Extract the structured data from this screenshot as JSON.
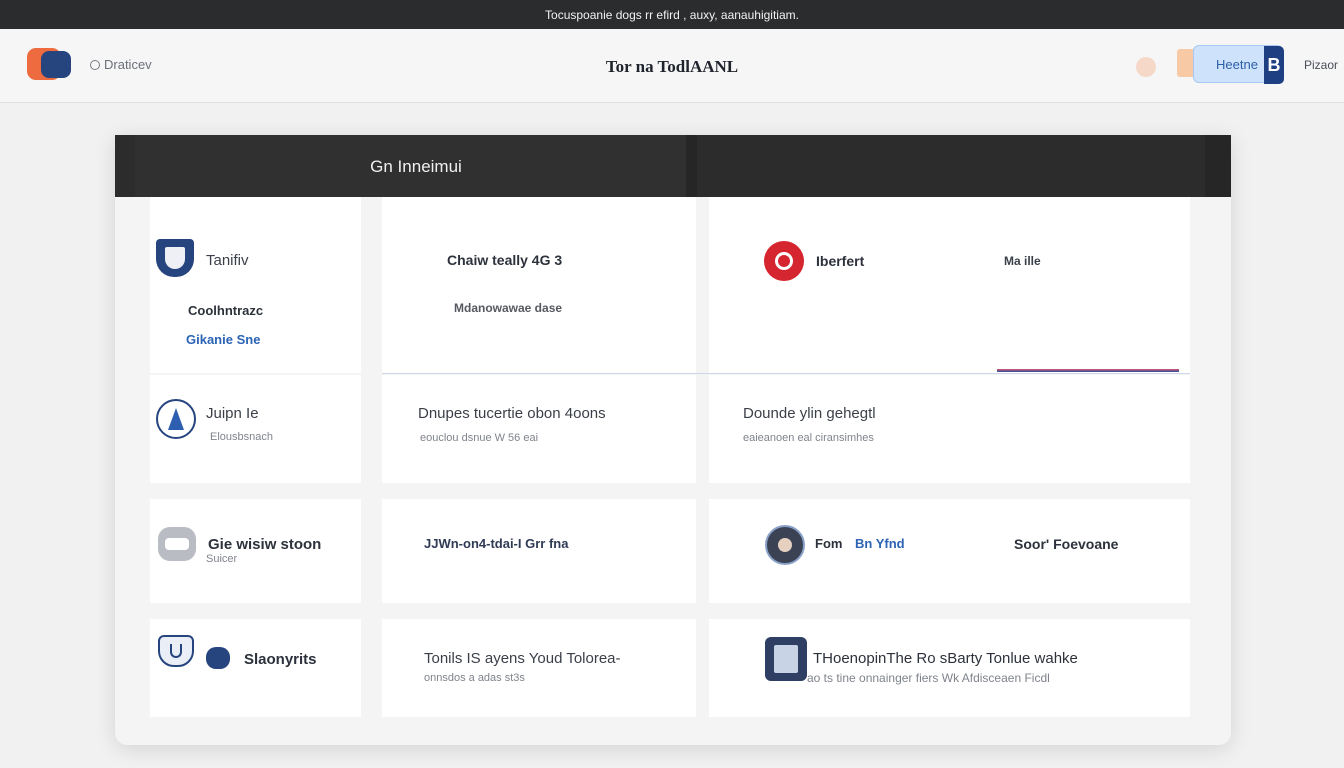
{
  "topbar": {
    "text": "Tocuspoanie dogs rr efird , auxy, aanauhigitiam."
  },
  "header": {
    "brand": "Draticev",
    "title": "Tor na TodlAANL",
    "primary_button": "Heetne",
    "primary_button_icon": "B",
    "extra_link": "Pizaor"
  },
  "panel": {
    "title": "Gn Inneimui"
  },
  "rows": [
    {
      "a": {
        "title": "Tanifiv",
        "line2": "Coolhntrazc",
        "line3": "Gikanie Sne",
        "icon": "shield-icon"
      },
      "b": {
        "title": "Chaiw teally 4G 3",
        "sub": "Mdanowawae dase"
      },
      "c": {
        "title": "Iberfert",
        "right": "Ma ille",
        "icon": "record-icon"
      }
    },
    {
      "a": {
        "title": "Juipn Ie",
        "sub": "Elousbsnach",
        "icon": "navigation-icon"
      },
      "b": {
        "title": "Dnupes tucertie obon 4oons",
        "sub": "eouclou dsnue   W 56 eai"
      },
      "c": {
        "title": "Dounde ylin gehegtl",
        "sub": "eaieanoen eal ciransimhes"
      }
    },
    {
      "a": {
        "title": "Gie wisiw stoon",
        "sub": "Suicer",
        "icon": "toggle-icon"
      },
      "b": {
        "title": "JJWn-on4-tdai-I Grr fna"
      },
      "c": {
        "title": "Fom",
        "link": "Bn Yfnd",
        "right": "Soor' Foevoane",
        "icon": "avatar-icon"
      }
    },
    {
      "a": {
        "title": "Slaonyrits",
        "icon": "badge-icon"
      },
      "b": {
        "title": "Tonils IS ayens Youd Tolorea-",
        "sub": "onnsdos a adas st3s"
      },
      "c": {
        "title": "THoenopinThe Ro sBarty Tonlue wahke",
        "sub": "ao ts tine onnainger fiers  Wk Afdisceaen Ficdl",
        "icon": "document-icon"
      }
    }
  ],
  "colors": {
    "accent": "#26457e",
    "red": "#d5252f",
    "link": "#2b63b5"
  }
}
